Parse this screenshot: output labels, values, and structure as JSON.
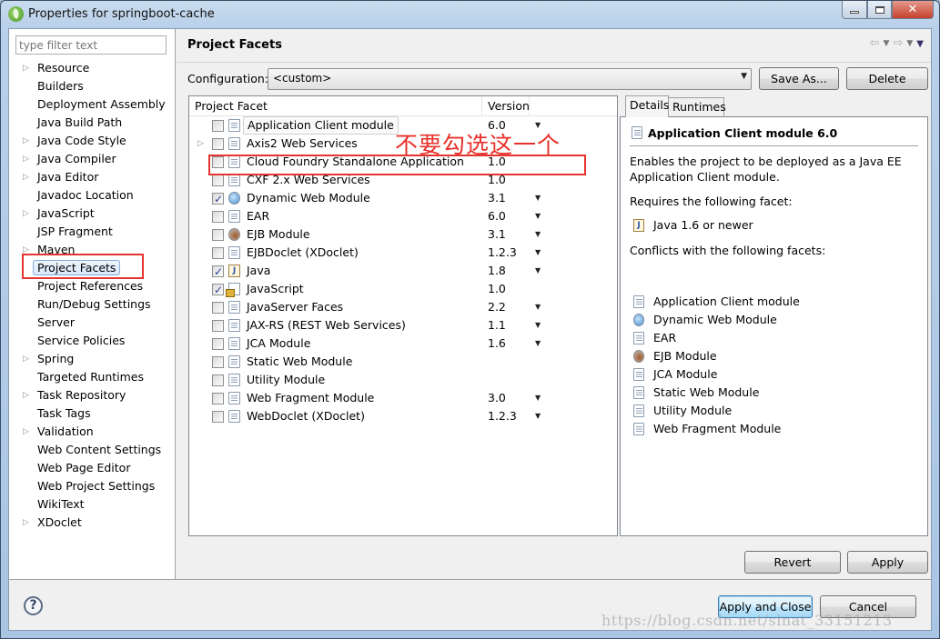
{
  "window": {
    "title": "Properties for springboot-cache",
    "controls": {
      "minimize": "minimize",
      "maximize": "maximize",
      "close": "✕"
    }
  },
  "sidebar": {
    "filter_placeholder": "type filter text",
    "items": [
      {
        "label": "Resource",
        "expandable": true
      },
      {
        "label": "Builders",
        "expandable": false
      },
      {
        "label": "Deployment Assembly",
        "expandable": false
      },
      {
        "label": "Java Build Path",
        "expandable": false
      },
      {
        "label": "Java Code Style",
        "expandable": true
      },
      {
        "label": "Java Compiler",
        "expandable": true
      },
      {
        "label": "Java Editor",
        "expandable": true
      },
      {
        "label": "Javadoc Location",
        "expandable": false
      },
      {
        "label": "JavaScript",
        "expandable": true
      },
      {
        "label": "JSP Fragment",
        "expandable": false
      },
      {
        "label": "Maven",
        "expandable": true
      },
      {
        "label": "Project Facets",
        "expandable": false,
        "selected": true
      },
      {
        "label": "Project References",
        "expandable": false
      },
      {
        "label": "Run/Debug Settings",
        "expandable": false
      },
      {
        "label": "Server",
        "expandable": false
      },
      {
        "label": "Service Policies",
        "expandable": false
      },
      {
        "label": "Spring",
        "expandable": true
      },
      {
        "label": "Targeted Runtimes",
        "expandable": false
      },
      {
        "label": "Task Repository",
        "expandable": true
      },
      {
        "label": "Task Tags",
        "expandable": false
      },
      {
        "label": "Validation",
        "expandable": true
      },
      {
        "label": "Web Content Settings",
        "expandable": false
      },
      {
        "label": "Web Page Editor",
        "expandable": false
      },
      {
        "label": "Web Project Settings",
        "expandable": false
      },
      {
        "label": "WikiText",
        "expandable": false
      },
      {
        "label": "XDoclet",
        "expandable": true
      }
    ]
  },
  "page": {
    "title": "Project Facets",
    "configuration_label": "Configuration:",
    "configuration_value": "<custom>",
    "save_as_label": "Save As...",
    "delete_label": "Delete",
    "annotation": "不要勾选这一个",
    "annotation_color": "#e8302a"
  },
  "facets": {
    "columns": [
      "Project Facet",
      "Version"
    ],
    "rows": [
      {
        "name": "Application Client module",
        "version": "6.0",
        "checked": false,
        "dropdown": true,
        "icon": "doc",
        "selected": true
      },
      {
        "name": "Axis2 Web Services",
        "version": "",
        "checked": false,
        "dropdown": false,
        "icon": "doc",
        "expandable": true
      },
      {
        "name": "Cloud Foundry Standalone Application",
        "version": "1.0",
        "checked": false,
        "dropdown": false,
        "icon": "doc",
        "highlighted": true
      },
      {
        "name": "CXF 2.x Web Services",
        "version": "1.0",
        "checked": false,
        "dropdown": false,
        "icon": "doc"
      },
      {
        "name": "Dynamic Web Module",
        "version": "3.1",
        "checked": true,
        "dropdown": true,
        "icon": "globe"
      },
      {
        "name": "EAR",
        "version": "6.0",
        "checked": false,
        "dropdown": true,
        "icon": "doc"
      },
      {
        "name": "EJB Module",
        "version": "3.1",
        "checked": false,
        "dropdown": true,
        "icon": "bean"
      },
      {
        "name": "EJBDoclet (XDoclet)",
        "version": "1.2.3",
        "checked": false,
        "dropdown": true,
        "icon": "doc"
      },
      {
        "name": "Java",
        "version": "1.8",
        "checked": true,
        "dropdown": true,
        "icon": "java"
      },
      {
        "name": "JavaScript",
        "version": "1.0",
        "checked": true,
        "dropdown": false,
        "icon": "lockdoc"
      },
      {
        "name": "JavaServer Faces",
        "version": "2.2",
        "checked": false,
        "dropdown": true,
        "icon": "doc"
      },
      {
        "name": "JAX-RS (REST Web Services)",
        "version": "1.1",
        "checked": false,
        "dropdown": true,
        "icon": "doc"
      },
      {
        "name": "JCA Module",
        "version": "1.6",
        "checked": false,
        "dropdown": true,
        "icon": "doc"
      },
      {
        "name": "Static Web Module",
        "version": "",
        "checked": false,
        "dropdown": false,
        "icon": "doc"
      },
      {
        "name": "Utility Module",
        "version": "",
        "checked": false,
        "dropdown": false,
        "icon": "doc"
      },
      {
        "name": "Web Fragment Module",
        "version": "3.0",
        "checked": false,
        "dropdown": true,
        "icon": "doc"
      },
      {
        "name": "WebDoclet (XDoclet)",
        "version": "1.2.3",
        "checked": false,
        "dropdown": true,
        "icon": "doc"
      }
    ]
  },
  "details": {
    "tabs": [
      "Details",
      "Runtimes"
    ],
    "active_tab": "Details",
    "title": "Application Client module 6.0",
    "description": "Enables the project to be deployed as a Java EE Application Client module.",
    "requires_label": "Requires the following facet:",
    "requires": [
      {
        "label": "Java 1.6 or newer",
        "icon": "java"
      }
    ],
    "conflicts_label": "Conflicts with the following facets:",
    "conflicts": [
      {
        "label": "Application Client module",
        "icon": "doc"
      },
      {
        "label": "Dynamic Web Module",
        "icon": "globe"
      },
      {
        "label": "EAR",
        "icon": "doc"
      },
      {
        "label": "EJB Module",
        "icon": "bean"
      },
      {
        "label": "JCA Module",
        "icon": "doc"
      },
      {
        "label": "Static Web Module",
        "icon": "doc"
      },
      {
        "label": "Utility Module",
        "icon": "doc"
      },
      {
        "label": "Web Fragment Module",
        "icon": "doc"
      }
    ]
  },
  "buttons": {
    "revert": "Revert",
    "apply": "Apply",
    "apply_and_close": "Apply and Close",
    "cancel": "Cancel"
  },
  "watermark": "https://blog.csdn.net/sinat_33151213"
}
